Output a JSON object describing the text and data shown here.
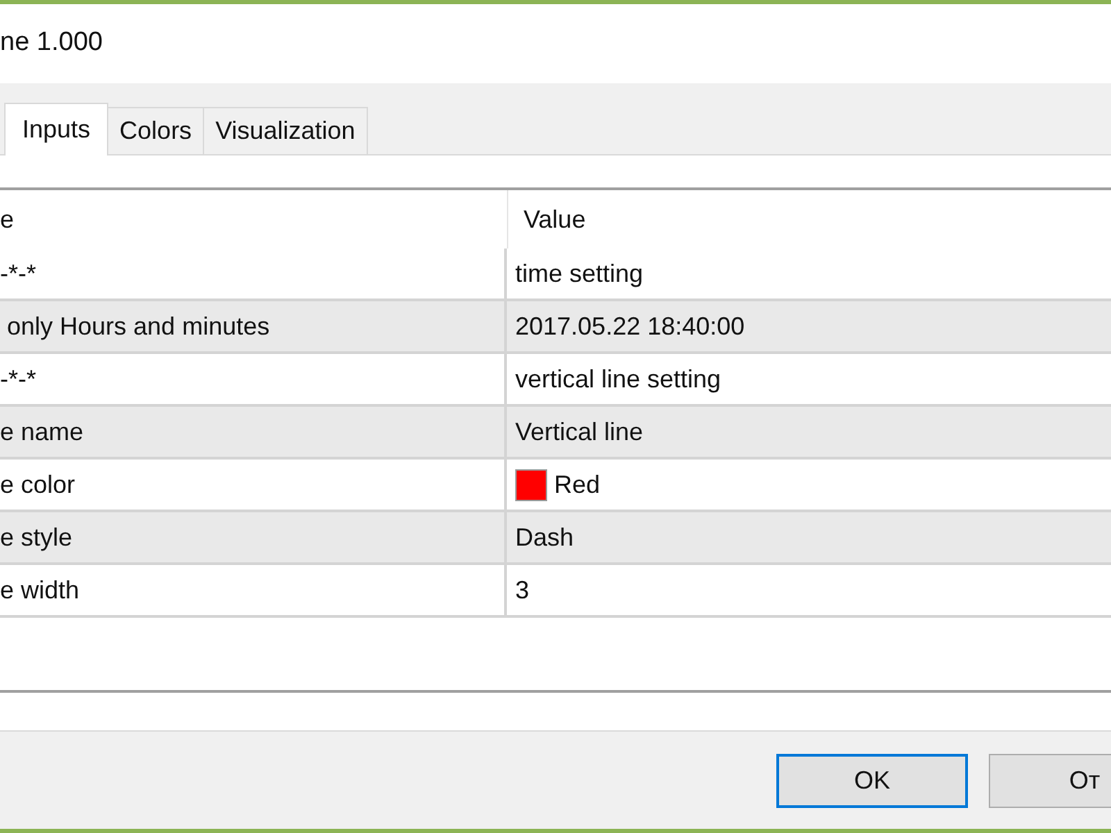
{
  "window": {
    "title": "ne 1.000"
  },
  "tabs": [
    {
      "label": "Inputs",
      "selected": true
    },
    {
      "label": "Colors",
      "selected": false
    },
    {
      "label": "Visualization",
      "selected": false
    }
  ],
  "table": {
    "columns": [
      "e",
      "Value"
    ],
    "rows": [
      {
        "kind": "text",
        "name": "-*-*",
        "value": "time setting"
      },
      {
        "kind": "text",
        "name": " only Hours and minutes",
        "value": "2017.05.22 18:40:00"
      },
      {
        "kind": "text",
        "name": "-*-*",
        "value": "vertical line setting"
      },
      {
        "kind": "text",
        "name": "e name",
        "value": "Vertical line"
      },
      {
        "kind": "color",
        "name": "e color",
        "value": "Red",
        "color": "#ff0000"
      },
      {
        "kind": "text",
        "name": "e style",
        "value": "Dash"
      },
      {
        "kind": "text",
        "name": "e width",
        "value": "3"
      }
    ]
  },
  "buttons": [
    {
      "label": "OK",
      "focused": true
    },
    {
      "label": "От",
      "focused": false
    }
  ]
}
